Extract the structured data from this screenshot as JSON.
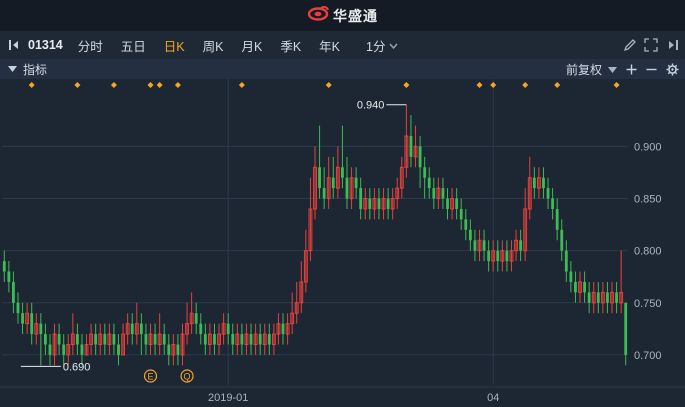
{
  "app": {
    "title": "华盛通"
  },
  "toolbar": {
    "code": "01314",
    "periods": [
      {
        "label": "分时",
        "active": false
      },
      {
        "label": "五日",
        "active": false
      },
      {
        "label": "日K",
        "active": true
      },
      {
        "label": "周K",
        "active": false
      },
      {
        "label": "月K",
        "active": false
      },
      {
        "label": "季K",
        "active": false
      },
      {
        "label": "年K",
        "active": false
      }
    ],
    "minute_select": "1分"
  },
  "indicator_bar": {
    "label": "指标",
    "adjust": "前复权"
  },
  "colors": {
    "up": "#e8413c",
    "down": "#3dbb55",
    "marker": "#f5a623",
    "grid": "#2c3a4b",
    "axis_text": "#aab4c0"
  },
  "chart_data": {
    "type": "candlestick",
    "yticks": [
      0.7,
      0.75,
      0.8,
      0.85,
      0.9
    ],
    "ylim": [
      0.675,
      0.957
    ],
    "xtick_labels": [
      {
        "label": "2019-01",
        "bar": 49
      },
      {
        "label": "04",
        "bar": 107
      }
    ],
    "bar_count": 138,
    "high_label": "0.940",
    "low_label": "0.690",
    "annotations": [
      {
        "label": "E",
        "bar": 32
      },
      {
        "label": "Q",
        "bar": 40
      }
    ],
    "event_marker_bars": [
      6,
      16,
      24,
      32,
      34,
      38,
      52,
      71,
      88,
      104,
      107,
      114,
      121,
      134
    ],
    "bars": [
      [
        0.79,
        0.78,
        0.8,
        0.77
      ],
      [
        0.78,
        0.77,
        0.79,
        0.76
      ],
      [
        0.77,
        0.75,
        0.78,
        0.74
      ],
      [
        0.75,
        0.74,
        0.76,
        0.73
      ],
      [
        0.74,
        0.73,
        0.75,
        0.72
      ],
      [
        0.73,
        0.74,
        0.75,
        0.72
      ],
      [
        0.74,
        0.72,
        0.75,
        0.71
      ],
      [
        0.72,
        0.73,
        0.74,
        0.71
      ],
      [
        0.73,
        0.72,
        0.74,
        0.69
      ],
      [
        0.72,
        0.71,
        0.73,
        0.7
      ],
      [
        0.71,
        0.7,
        0.72,
        0.69
      ],
      [
        0.7,
        0.72,
        0.73,
        0.69
      ],
      [
        0.72,
        0.71,
        0.73,
        0.7
      ],
      [
        0.71,
        0.7,
        0.72,
        0.69
      ],
      [
        0.7,
        0.71,
        0.72,
        0.69
      ],
      [
        0.71,
        0.72,
        0.74,
        0.7
      ],
      [
        0.72,
        0.71,
        0.73,
        0.7
      ],
      [
        0.71,
        0.7,
        0.72,
        0.69
      ],
      [
        0.7,
        0.71,
        0.72,
        0.7
      ],
      [
        0.71,
        0.72,
        0.73,
        0.7
      ],
      [
        0.72,
        0.71,
        0.73,
        0.7
      ],
      [
        0.71,
        0.72,
        0.73,
        0.7
      ],
      [
        0.72,
        0.71,
        0.73,
        0.7
      ],
      [
        0.71,
        0.72,
        0.73,
        0.7
      ],
      [
        0.72,
        0.71,
        0.73,
        0.7
      ],
      [
        0.71,
        0.7,
        0.72,
        0.69
      ],
      [
        0.7,
        0.72,
        0.73,
        0.7
      ],
      [
        0.72,
        0.73,
        0.74,
        0.71
      ],
      [
        0.73,
        0.72,
        0.74,
        0.71
      ],
      [
        0.72,
        0.73,
        0.75,
        0.71
      ],
      [
        0.73,
        0.72,
        0.74,
        0.7
      ],
      [
        0.72,
        0.71,
        0.73,
        0.7
      ],
      [
        0.71,
        0.72,
        0.73,
        0.7
      ],
      [
        0.72,
        0.71,
        0.73,
        0.7
      ],
      [
        0.71,
        0.72,
        0.74,
        0.7
      ],
      [
        0.72,
        0.71,
        0.73,
        0.7
      ],
      [
        0.71,
        0.7,
        0.72,
        0.69
      ],
      [
        0.7,
        0.71,
        0.72,
        0.69
      ],
      [
        0.71,
        0.7,
        0.72,
        0.69
      ],
      [
        0.7,
        0.72,
        0.73,
        0.69
      ],
      [
        0.72,
        0.73,
        0.75,
        0.71
      ],
      [
        0.73,
        0.74,
        0.76,
        0.72
      ],
      [
        0.74,
        0.73,
        0.75,
        0.72
      ],
      [
        0.73,
        0.72,
        0.74,
        0.71
      ],
      [
        0.72,
        0.71,
        0.73,
        0.7
      ],
      [
        0.71,
        0.72,
        0.73,
        0.7
      ],
      [
        0.72,
        0.71,
        0.73,
        0.7
      ],
      [
        0.71,
        0.72,
        0.73,
        0.7
      ],
      [
        0.72,
        0.73,
        0.74,
        0.71
      ],
      [
        0.73,
        0.72,
        0.74,
        0.71
      ],
      [
        0.72,
        0.71,
        0.73,
        0.7
      ],
      [
        0.71,
        0.72,
        0.73,
        0.7
      ],
      [
        0.72,
        0.71,
        0.73,
        0.7
      ],
      [
        0.71,
        0.72,
        0.73,
        0.7
      ],
      [
        0.72,
        0.71,
        0.73,
        0.7
      ],
      [
        0.71,
        0.72,
        0.73,
        0.7
      ],
      [
        0.72,
        0.71,
        0.73,
        0.7
      ],
      [
        0.71,
        0.72,
        0.73,
        0.7
      ],
      [
        0.72,
        0.71,
        0.73,
        0.7
      ],
      [
        0.71,
        0.72,
        0.73,
        0.7
      ],
      [
        0.72,
        0.73,
        0.74,
        0.71
      ],
      [
        0.73,
        0.72,
        0.74,
        0.71
      ],
      [
        0.72,
        0.73,
        0.74,
        0.71
      ],
      [
        0.73,
        0.74,
        0.76,
        0.72
      ],
      [
        0.74,
        0.75,
        0.77,
        0.73
      ],
      [
        0.75,
        0.77,
        0.79,
        0.74
      ],
      [
        0.77,
        0.8,
        0.82,
        0.76
      ],
      [
        0.8,
        0.84,
        0.87,
        0.79
      ],
      [
        0.84,
        0.88,
        0.9,
        0.83
      ],
      [
        0.88,
        0.86,
        0.92,
        0.85
      ],
      [
        0.86,
        0.85,
        0.88,
        0.84
      ],
      [
        0.85,
        0.87,
        0.89,
        0.84
      ],
      [
        0.87,
        0.86,
        0.89,
        0.85
      ],
      [
        0.86,
        0.88,
        0.9,
        0.85
      ],
      [
        0.88,
        0.87,
        0.92,
        0.86
      ],
      [
        0.87,
        0.85,
        0.89,
        0.84
      ],
      [
        0.85,
        0.87,
        0.88,
        0.84
      ],
      [
        0.87,
        0.86,
        0.88,
        0.85
      ],
      [
        0.86,
        0.84,
        0.87,
        0.83
      ],
      [
        0.84,
        0.85,
        0.86,
        0.83
      ],
      [
        0.85,
        0.84,
        0.86,
        0.83
      ],
      [
        0.84,
        0.85,
        0.86,
        0.83
      ],
      [
        0.85,
        0.84,
        0.86,
        0.83
      ],
      [
        0.84,
        0.85,
        0.86,
        0.83
      ],
      [
        0.85,
        0.84,
        0.86,
        0.83
      ],
      [
        0.84,
        0.85,
        0.86,
        0.83
      ],
      [
        0.85,
        0.86,
        0.87,
        0.84
      ],
      [
        0.86,
        0.88,
        0.89,
        0.85
      ],
      [
        0.88,
        0.91,
        0.94,
        0.87
      ],
      [
        0.91,
        0.89,
        0.93,
        0.88
      ],
      [
        0.89,
        0.9,
        0.92,
        0.88
      ],
      [
        0.9,
        0.88,
        0.91,
        0.86
      ],
      [
        0.88,
        0.87,
        0.89,
        0.85
      ],
      [
        0.87,
        0.86,
        0.88,
        0.85
      ],
      [
        0.86,
        0.85,
        0.87,
        0.84
      ],
      [
        0.85,
        0.86,
        0.87,
        0.84
      ],
      [
        0.86,
        0.85,
        0.87,
        0.84
      ],
      [
        0.85,
        0.84,
        0.86,
        0.83
      ],
      [
        0.84,
        0.85,
        0.86,
        0.83
      ],
      [
        0.85,
        0.84,
        0.86,
        0.83
      ],
      [
        0.84,
        0.83,
        0.85,
        0.82
      ],
      [
        0.83,
        0.82,
        0.84,
        0.81
      ],
      [
        0.82,
        0.81,
        0.83,
        0.8
      ],
      [
        0.81,
        0.8,
        0.82,
        0.79
      ],
      [
        0.8,
        0.81,
        0.82,
        0.79
      ],
      [
        0.81,
        0.8,
        0.82,
        0.79
      ],
      [
        0.8,
        0.79,
        0.81,
        0.78
      ],
      [
        0.79,
        0.8,
        0.81,
        0.78
      ],
      [
        0.8,
        0.79,
        0.81,
        0.78
      ],
      [
        0.79,
        0.8,
        0.81,
        0.78
      ],
      [
        0.8,
        0.79,
        0.81,
        0.78
      ],
      [
        0.79,
        0.8,
        0.81,
        0.78
      ],
      [
        0.8,
        0.81,
        0.82,
        0.79
      ],
      [
        0.81,
        0.8,
        0.82,
        0.79
      ],
      [
        0.8,
        0.84,
        0.86,
        0.79
      ],
      [
        0.84,
        0.87,
        0.89,
        0.83
      ],
      [
        0.87,
        0.86,
        0.88,
        0.85
      ],
      [
        0.86,
        0.87,
        0.88,
        0.85
      ],
      [
        0.87,
        0.86,
        0.88,
        0.85
      ],
      [
        0.86,
        0.85,
        0.87,
        0.84
      ],
      [
        0.85,
        0.84,
        0.86,
        0.83
      ],
      [
        0.84,
        0.82,
        0.85,
        0.81
      ],
      [
        0.82,
        0.8,
        0.83,
        0.79
      ],
      [
        0.8,
        0.78,
        0.81,
        0.77
      ],
      [
        0.78,
        0.77,
        0.79,
        0.76
      ],
      [
        0.77,
        0.76,
        0.78,
        0.75
      ],
      [
        0.76,
        0.77,
        0.78,
        0.75
      ],
      [
        0.77,
        0.76,
        0.78,
        0.75
      ],
      [
        0.76,
        0.75,
        0.77,
        0.74
      ],
      [
        0.75,
        0.76,
        0.77,
        0.74
      ],
      [
        0.76,
        0.75,
        0.77,
        0.74
      ],
      [
        0.75,
        0.76,
        0.77,
        0.74
      ],
      [
        0.76,
        0.75,
        0.77,
        0.74
      ],
      [
        0.75,
        0.76,
        0.77,
        0.74
      ],
      [
        0.76,
        0.75,
        0.77,
        0.74
      ],
      [
        0.75,
        0.76,
        0.8,
        0.74
      ],
      [
        0.75,
        0.7,
        0.75,
        0.69
      ]
    ]
  }
}
